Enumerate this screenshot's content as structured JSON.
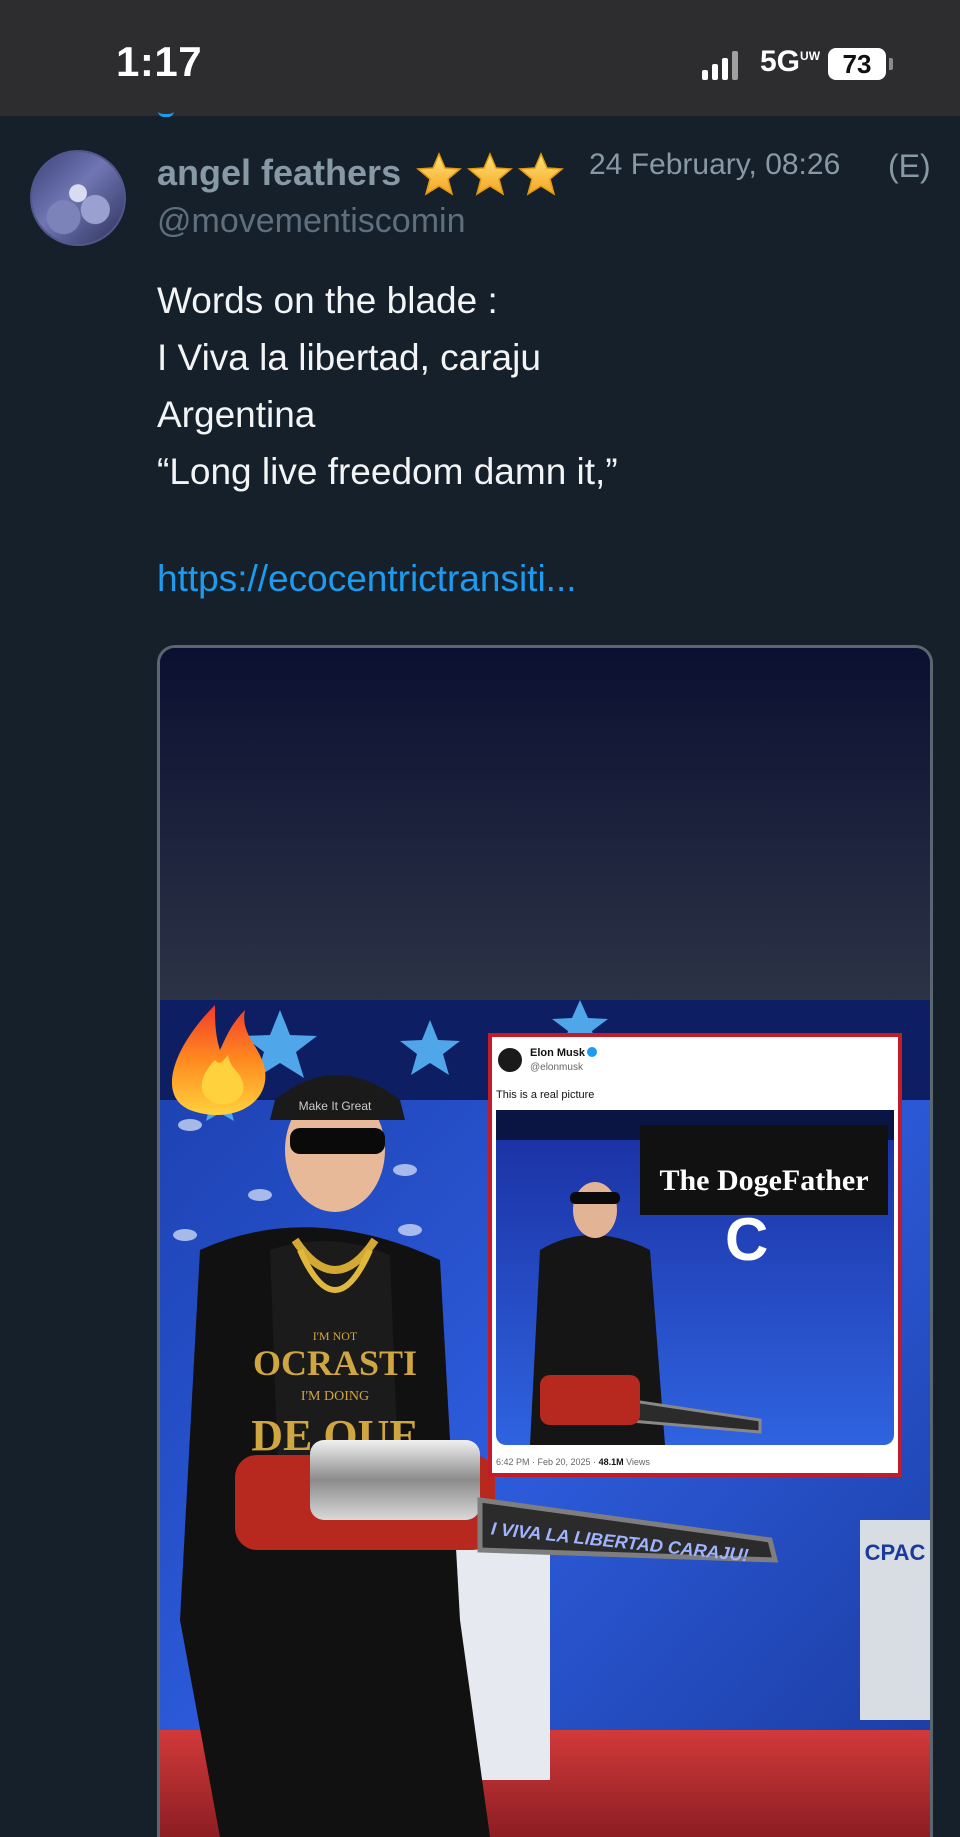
{
  "status_bar": {
    "time": "1:17",
    "network": "5G",
    "network_superscript": "UW",
    "battery": "73"
  },
  "post": {
    "user_name": "angel feathers",
    "badge": "star-icon x3",
    "timestamp": "24 February, 08:26",
    "edited_marker": "(E)",
    "handle": "@movementiscomin",
    "text_lines": [
      "Words on the blade :",
      "I Viva la libertad, caraju",
      "Argentina",
      "“Long live freedom damn it,”"
    ],
    "link": "https://ecocentrictransiti..."
  },
  "media": {
    "embedded_tweet": {
      "name": "Elon Musk",
      "handle": "@elonmusk",
      "text": "This is a real picture",
      "image_text": "The DogeFather",
      "footer_date": "6:42 PM · Feb 20, 2025 · ",
      "views": "48.1M",
      "views_label": " Views"
    },
    "blade_text": "I VIVA LA LIBERTAD CARAJU!",
    "shirt_lines": [
      "I'M NOT",
      "OCRASTI",
      "I'M DOING",
      "DE QUE"
    ],
    "cap_text": "Make It Great",
    "sign_text": "CPAC"
  },
  "colors": {
    "background": "#16202a",
    "status_bar": "#2d2d2f",
    "name_grey": "#8899a6",
    "handle_grey": "#5e6f7d",
    "link_blue": "#1d9bf0",
    "text_white": "#f2f4f6",
    "star_gold": "#ffcc33",
    "tweet_frame_red": "#c41b2a"
  }
}
